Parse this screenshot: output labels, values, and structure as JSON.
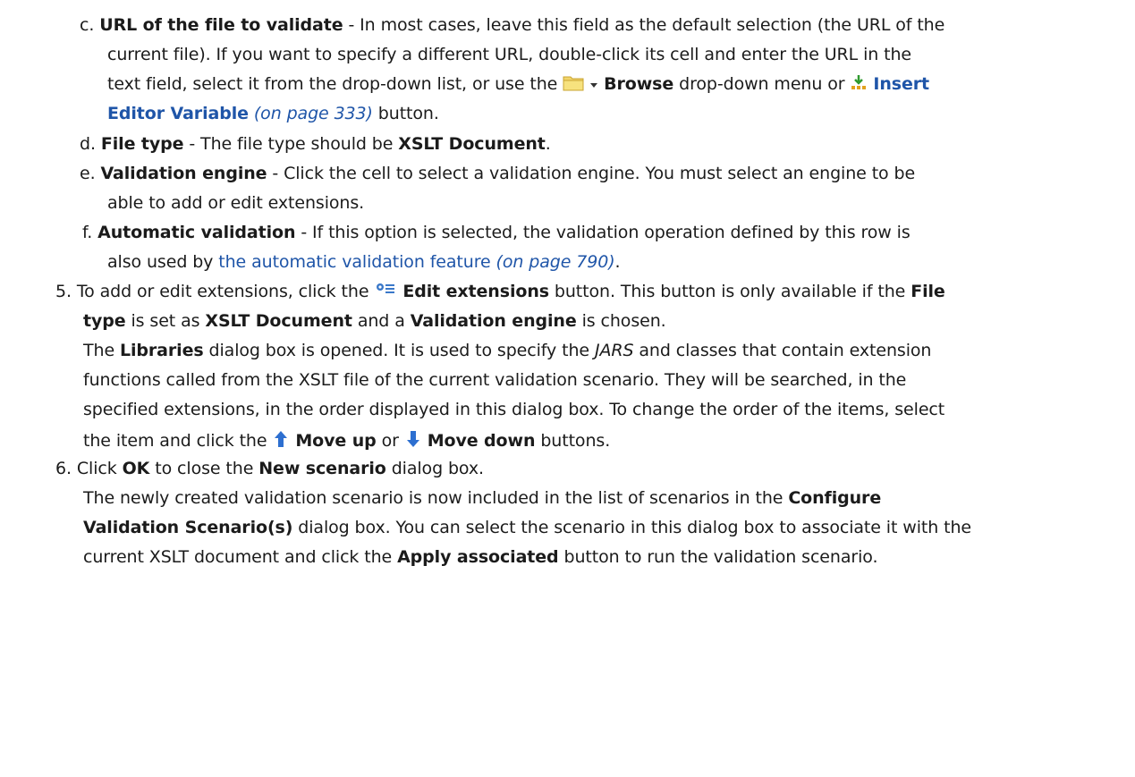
{
  "item_c": {
    "marker": "c.",
    "term": "URL of the file to validate",
    "t1": " - In most cases, leave this field as the default selection (the URL of the",
    "t2": "current file). If you want to specify a different URL, double-click its cell and enter the URL in the",
    "t3a": "text field, select it from the drop-down list, or use the ",
    "browse": "Browse",
    "t3b": " drop-down menu or ",
    "insert": "Insert",
    "editor_variable": "Editor Variable",
    "page_ref": "(on page 333)",
    "t4": " button."
  },
  "item_d": {
    "marker": "d.",
    "term": "File type",
    "t1": " - The file type should be ",
    "value": "XSLT Document",
    "end": "."
  },
  "item_e": {
    "marker": "e.",
    "term": "Validation engine",
    "t1": " - Click the cell to select a validation engine. You must select an engine to be",
    "t2": "able to add or edit extensions."
  },
  "item_f": {
    "marker": "f.",
    "term": "Automatic validation",
    "t1": " - If this option is selected, the validation operation defined by this row is",
    "t2a": "also used by ",
    "link": "the automatic validation feature",
    "page_ref": "(on page 790)",
    "end": "."
  },
  "step5": {
    "marker": "5.",
    "t1a": "To add or edit extensions, click the ",
    "edit_extensions": "Edit extensions",
    "t1b": " button. This button is only available if the ",
    "file": "File",
    "type": "type",
    "t2a": " is set as ",
    "xslt_document": "XSLT Document",
    "t2b": " and a ",
    "validation_engine": "Validation engine",
    "t2c": " is chosen.",
    "t3a": "The ",
    "libraries": "Libraries",
    "t3b": " dialog box is opened. It is used to specify the ",
    "jars": "JARS",
    "t3c": " and classes that contain extension",
    "t4": "functions called from the XSLT file of the current validation scenario. They will be searched, in the",
    "t5": "specified extensions, in the order displayed in this dialog box. To change the order of the items, select",
    "t6a": "the item and click the ",
    "move_up": "Move up",
    "or": " or ",
    "move_down": "Move down",
    "t6b": " buttons."
  },
  "step6": {
    "marker": "6.",
    "t1a": "Click ",
    "ok": "OK",
    "t1b": " to close the ",
    "new_scenario": "New scenario",
    "t1c": " dialog box.",
    "t2a": "The newly created validation scenario is now included in the list of scenarios in the ",
    "configure": "Configure",
    "configure2": "Validation Scenario(s)",
    "t3b": " dialog box. You can select the scenario in this dialog box to associate it with the",
    "t4a": "current XSLT document and click the ",
    "apply": "Apply associated",
    "t4b": " button to run the validation scenario."
  },
  "icons": [
    "folder-icon",
    "dropdown-arrow-icon",
    "insert-variable-icon",
    "edit-extensions-icon",
    "move-up-icon",
    "move-down-icon"
  ],
  "colors": {
    "link": "#1f55a8",
    "text": "#1b1b1b"
  }
}
